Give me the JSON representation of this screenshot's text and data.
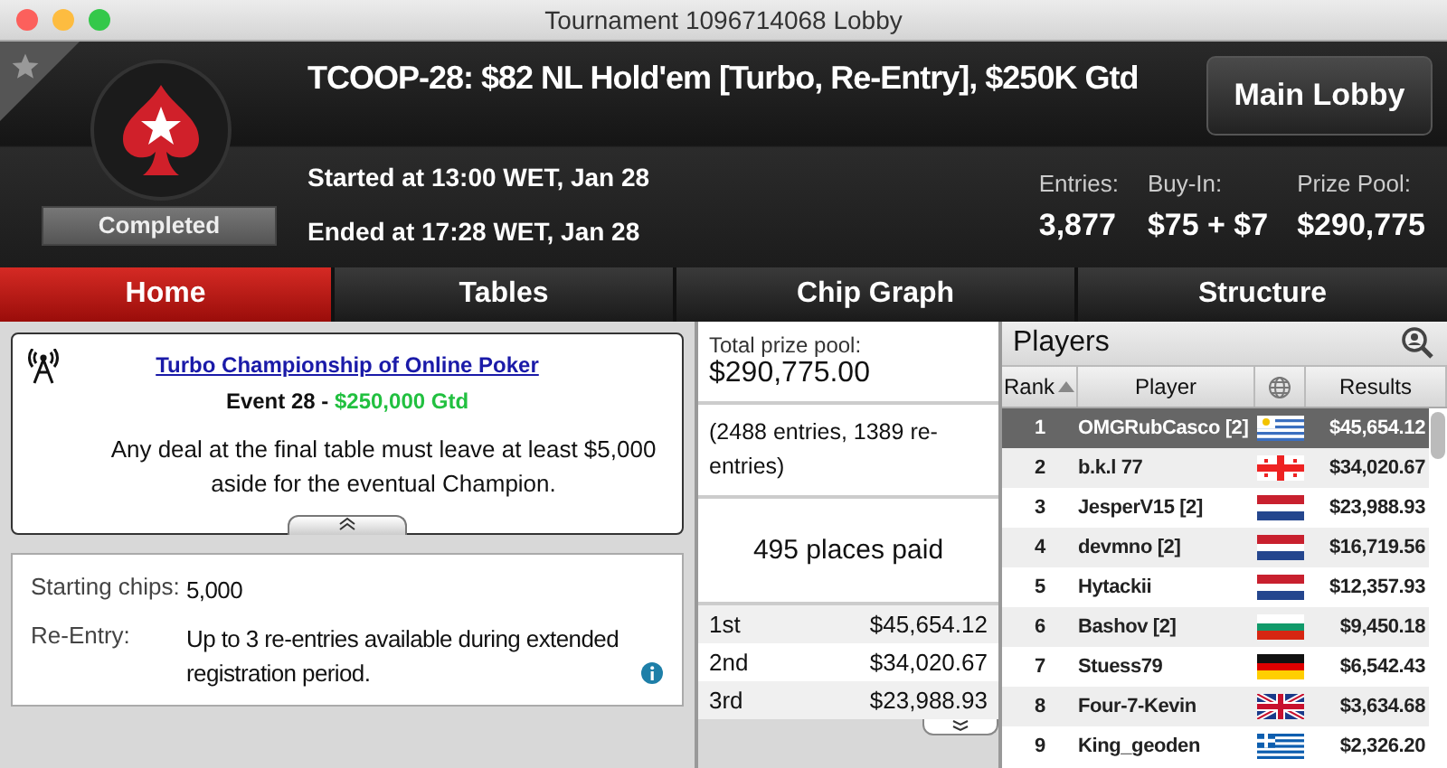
{
  "window": {
    "title": "Tournament 1096714068 Lobby"
  },
  "header": {
    "title": "TCOOP-28: $82 NL Hold'em [Turbo, Re-Entry], $250K Gtd",
    "status": "Completed",
    "started": "Started at 13:00 WET, Jan 28",
    "ended": "Ended at 17:28 WET, Jan 28",
    "main_lobby_button": "Main Lobby",
    "stats": [
      {
        "label": "Entries:",
        "value": "3,877"
      },
      {
        "label": "Buy-In:",
        "value": "$75 + $7"
      },
      {
        "label": "Prize Pool:",
        "value": "$290,775"
      }
    ]
  },
  "tabs": [
    {
      "label": "Home",
      "selected": true
    },
    {
      "label": "Tables",
      "selected": false
    },
    {
      "label": "Chip Graph",
      "selected": false
    },
    {
      "label": "Structure",
      "selected": false
    }
  ],
  "announcement": {
    "link": "Turbo Championship of Online Poker",
    "event": "Event 28 - ",
    "guarantee": "$250,000 Gtd",
    "body": "Any deal at the final table must leave at least $5,000 aside for the eventual Champion."
  },
  "details": [
    {
      "label": "Starting chips:",
      "value": "5,000",
      "info": false
    },
    {
      "label": "Re-Entry:",
      "value": "Up to 3 re-entries available during extended registration period.",
      "info": true
    }
  ],
  "prizes": {
    "total_label": "Total prize pool:",
    "total": "$290,775.00",
    "entries": "(2488 entries, 1389 re-entries)",
    "places_paid": "495 places paid",
    "payouts": [
      {
        "place": "1st",
        "amount": "$45,654.12"
      },
      {
        "place": "2nd",
        "amount": "$34,020.67"
      },
      {
        "place": "3rd",
        "amount": "$23,988.93"
      }
    ]
  },
  "players": {
    "title": "Players",
    "columns": [
      "Rank",
      "Player",
      "Results"
    ],
    "rows": [
      {
        "rank": "1",
        "player": "OMGRubCasco [2]",
        "kind": "uy",
        "result": "$45,654.12",
        "selected": true
      },
      {
        "rank": "2",
        "player": "b.k.l 77",
        "kind": "ge",
        "result": "$34,020.67",
        "selected": false
      },
      {
        "rank": "3",
        "player": "JesperV15 [2]",
        "kind": "nl",
        "result": "$23,988.93",
        "selected": false
      },
      {
        "rank": "4",
        "player": "devmno [2]",
        "kind": "nl",
        "result": "$16,719.56",
        "selected": false
      },
      {
        "rank": "5",
        "player": "Hytackii",
        "kind": "nl",
        "result": "$12,357.93",
        "selected": false
      },
      {
        "rank": "6",
        "player": "Bashov [2]",
        "kind": "bg",
        "result": "$9,450.18",
        "selected": false
      },
      {
        "rank": "7",
        "player": "Stuess79",
        "kind": "de",
        "result": "$6,542.43",
        "selected": false
      },
      {
        "rank": "8",
        "player": "Four-7-Kevin",
        "kind": "gb",
        "result": "$3,634.68",
        "selected": false
      },
      {
        "rank": "9",
        "player": "King_geoden",
        "kind": "gr",
        "result": "$2,326.20",
        "selected": false
      }
    ]
  }
}
